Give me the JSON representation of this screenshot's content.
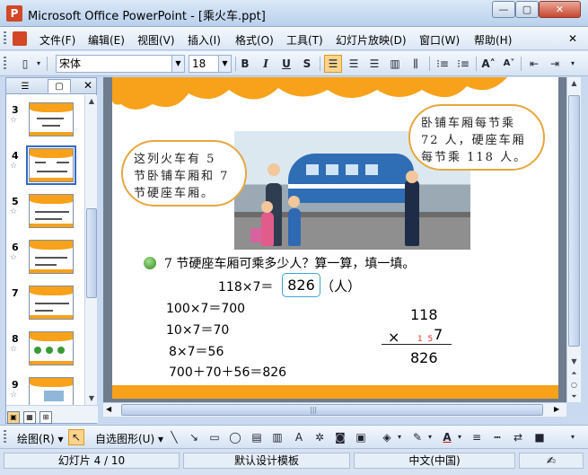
{
  "window": {
    "title": "Microsoft Office PowerPoint - [乘火车.ppt]",
    "min_label": "—",
    "max_label": "▢",
    "close_label": "✕"
  },
  "menu": {
    "items": [
      "文件(F)",
      "编辑(E)",
      "视图(V)",
      "插入(I)",
      "格式(O)",
      "工具(T)",
      "幻灯片放映(D)",
      "窗口(W)",
      "帮助(H)"
    ],
    "close_label": "✕"
  },
  "toolbar": {
    "font_name": "宋体",
    "font_size": "18",
    "bold": "B",
    "italic": "I",
    "underline": "U",
    "shadow": "S"
  },
  "left_panel": {
    "slides": [
      {
        "num": "3",
        "star": "☆"
      },
      {
        "num": "4",
        "star": "☆",
        "selected": true
      },
      {
        "num": "5",
        "star": "☆"
      },
      {
        "num": "6",
        "star": "☆"
      },
      {
        "num": "7",
        "star": ""
      },
      {
        "num": "8",
        "star": "☆"
      },
      {
        "num": "9",
        "star": "☆"
      }
    ],
    "close_label": "✕"
  },
  "slide": {
    "bubble_left": "这列火车有 5 节卧铺车厢和 7 节硬座车厢。",
    "bubble_right": "卧铺车厢每节乘 72 人，硬座车厢每节乘 118 人。",
    "question": "7 节硬座车厢可乘多少人？算一算，填一填。",
    "equation": "118×7＝",
    "answer": "826",
    "unit": "（人）",
    "steps": [
      "100×7＝700",
      "10×7＝70",
      "8×7＝56",
      "700＋70＋56＝826"
    ],
    "vertical": {
      "top": "118",
      "op": "×",
      "carry": "1  5",
      "bottom": "7",
      "result": "826"
    }
  },
  "drawbar": {
    "draw_label": "绘图(R) ▾",
    "autoshapes_label": "自选图形(U) ▾"
  },
  "status": {
    "slide_info": "幻灯片 4 / 10",
    "template": "默认设计模板",
    "language": "中文(中国)"
  },
  "colors": {
    "accent_orange": "#f7a21a",
    "selection": "#316ac5",
    "answer_border": "#3ea3d6"
  }
}
